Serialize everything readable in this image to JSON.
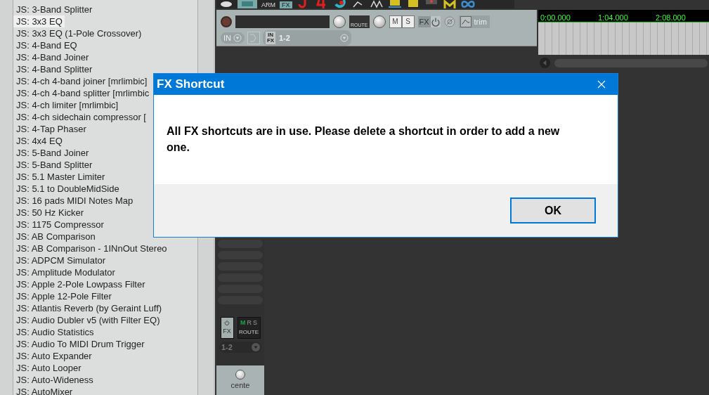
{
  "fx_list": {
    "items": [
      {
        "label": "JS: 3-Band Splitter",
        "selected": false
      },
      {
        "label": "JS: 3x3 EQ",
        "selected": true
      },
      {
        "label": "JS: 3x3 EQ (1-Pole Crossover)",
        "selected": false
      },
      {
        "label": "JS: 4-Band EQ",
        "selected": false
      },
      {
        "label": "JS: 4-Band Joiner",
        "selected": false
      },
      {
        "label": "JS: 4-Band Splitter",
        "selected": false
      },
      {
        "label": "JS: 4-ch 4-band joiner [mrlimbic]",
        "selected": false
      },
      {
        "label": "JS: 4-ch 4-band splitter [mrlimbic",
        "selected": false
      },
      {
        "label": "JS: 4-ch limiter [mrlimbic]",
        "selected": false
      },
      {
        "label": "JS: 4-ch sidechain compressor [",
        "selected": false
      },
      {
        "label": "JS: 4-Tap Phaser",
        "selected": false
      },
      {
        "label": "JS: 4x4 EQ",
        "selected": false
      },
      {
        "label": "JS: 5-Band Joiner",
        "selected": false
      },
      {
        "label": "JS: 5-Band Splitter",
        "selected": false
      },
      {
        "label": "JS: 5.1 Master Limiter",
        "selected": false
      },
      {
        "label": "JS: 5.1 to DoubleMidSide",
        "selected": false
      },
      {
        "label": "JS: 16 pads MIDI Notes Map",
        "selected": false
      },
      {
        "label": "JS: 50 Hz Kicker",
        "selected": false
      },
      {
        "label": "JS: 1175 Compressor",
        "selected": false
      },
      {
        "label": "JS: AB Comparison",
        "selected": false
      },
      {
        "label": "JS: AB Comparison - 1INnOut Stereo",
        "selected": false
      },
      {
        "label": "JS: ADPCM Simulator",
        "selected": false
      },
      {
        "label": "JS: Amplitude Modulator",
        "selected": false
      },
      {
        "label": "JS: Apple 2-Pole Lowpass Filter",
        "selected": false
      },
      {
        "label": "JS: Apple 12-Pole Filter",
        "selected": false
      },
      {
        "label": "JS: Atlantis Reverb (by Geraint Luff)",
        "selected": false
      },
      {
        "label": "JS: Audio Dubler v5 (with Filter EQ)",
        "selected": false
      },
      {
        "label": "JS: Audio Statistics",
        "selected": false
      },
      {
        "label": "JS: Audio To MIDI Drum Trigger",
        "selected": false
      },
      {
        "label": "JS: Auto Expander",
        "selected": false
      },
      {
        "label": "JS: Auto Looper",
        "selected": false
      },
      {
        "label": "JS: Auto-Wideness",
        "selected": false
      },
      {
        "label": "JS: AutoMixer",
        "selected": false
      }
    ]
  },
  "toolbar": {
    "arm_label": "ARM",
    "fx_label": "FX"
  },
  "track": {
    "route_label": "ROUTE",
    "mute_label": "M",
    "solo_label": "S",
    "fx_label": "FX",
    "trim_label": "trim",
    "input_label": "IN",
    "input_fx_label": "IN FX",
    "input_channel": "1-2"
  },
  "ruler": {
    "times": [
      "0:00.000",
      "1:04.000",
      "2:08.000"
    ]
  },
  "mixer": {
    "fx_label": "FX",
    "route_label": "ROUTE",
    "route_flags": [
      {
        "label": "M",
        "on": true
      },
      {
        "label": "R",
        "on": false
      },
      {
        "label": "S",
        "on": false
      }
    ],
    "input_channel": "1-2",
    "pan_label": "cente"
  },
  "dialog": {
    "title": "FX Shortcut",
    "message": "All FX shortcuts are in use. Please delete a shortcut in order to add a new one.",
    "ok_label": "OK"
  }
}
